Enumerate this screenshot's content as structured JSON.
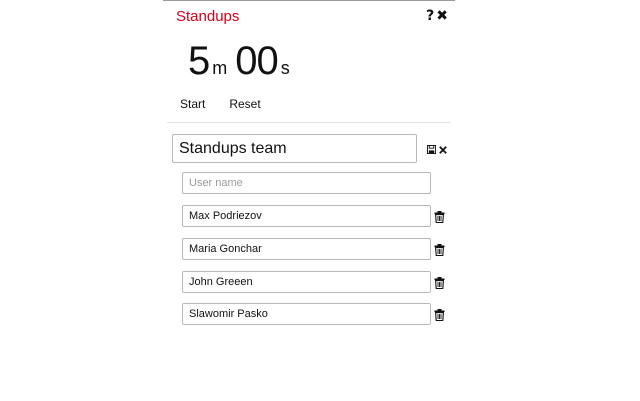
{
  "app": {
    "title": "Standups",
    "help_icon": "question-mark-icon",
    "close_icon": "close-icon"
  },
  "timer": {
    "minutes": "5",
    "minutes_unit": "m",
    "seconds": "00",
    "seconds_unit": "s"
  },
  "controls": {
    "start_label": "Start",
    "reset_label": "Reset"
  },
  "team": {
    "name": "Standups team",
    "save_icon": "save-disk-icon",
    "delete_icon": "close-icon"
  },
  "new_user": {
    "value": "",
    "placeholder": "User name"
  },
  "users": [
    {
      "name": "Max Podriezov",
      "icon": "trash-icon"
    },
    {
      "name": "Maria Gonchar",
      "icon": "trash-icon"
    },
    {
      "name": "John Greeen",
      "icon": "trash-icon"
    },
    {
      "name": "Slawomir Pasko",
      "icon": "trash-icon"
    }
  ],
  "colors": {
    "accent": "#d0021b",
    "border": "#b8b8b8",
    "divider": "#e4e4e4"
  }
}
